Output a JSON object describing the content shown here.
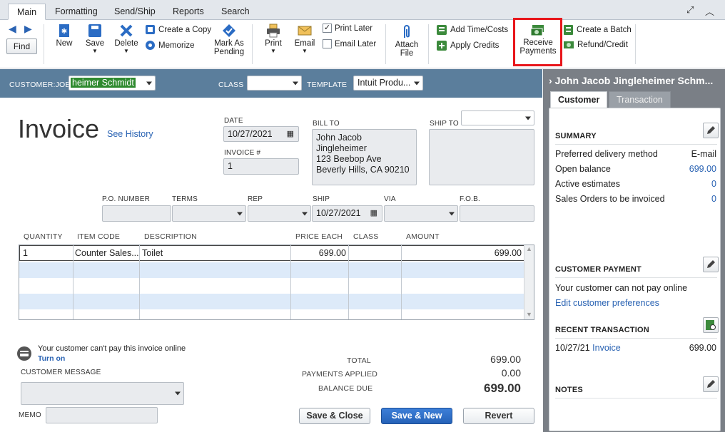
{
  "tabs": [
    "Main",
    "Formatting",
    "Send/Ship",
    "Reports",
    "Search"
  ],
  "toolbar": {
    "find": "Find",
    "new": "New",
    "save": "Save",
    "delete": "Delete",
    "create_copy": "Create a Copy",
    "memorize": "Memorize",
    "mark_as_pending_1": "Mark As",
    "mark_as_pending_2": "Pending",
    "print": "Print",
    "email": "Email",
    "print_later": "Print Later",
    "email_later": "Email Later",
    "attach_file_1": "Attach",
    "attach_file_2": "File",
    "add_time_costs": "Add Time/Costs",
    "apply_credits": "Apply Credits",
    "receive_payments_1": "Receive",
    "receive_payments_2": "Payments",
    "create_batch": "Create a Batch",
    "refund_credit": "Refund/Credit"
  },
  "header": {
    "customer_job_label": "CUSTOMER:JOB",
    "customer_job_value": "heimer Schmidt",
    "class_label": "CLASS",
    "template_label": "TEMPLATE",
    "template_value": "Intuit Produ..."
  },
  "form": {
    "title": "Invoice",
    "see_history": "See History",
    "date_label": "DATE",
    "date_value": "10/27/2021",
    "invoice_no_label": "INVOICE #",
    "invoice_no_value": "1",
    "bill_to_label": "BILL TO",
    "bill_to_lines": [
      "John Jacob Jingleheimer",
      "123 Beebop Ave",
      "Beverly Hills, CA 90210"
    ],
    "ship_to_label": "SHIP TO",
    "po_label": "P.O. NUMBER",
    "terms_label": "TERMS",
    "rep_label": "REP",
    "ship_label": "SHIP",
    "ship_value": "10/27/2021",
    "via_label": "VIA",
    "fob_label": "F.O.B."
  },
  "grid": {
    "columns": [
      "QUANTITY",
      "ITEM CODE",
      "DESCRIPTION",
      "PRICE EACH",
      "CLASS",
      "AMOUNT"
    ],
    "rows": [
      {
        "quantity": "1",
        "item_code": "Counter Sales...",
        "description": "Toilet",
        "price_each": "699.00",
        "class": "",
        "amount": "699.00"
      }
    ]
  },
  "footer": {
    "online_msg": "Your customer can't pay this invoice online",
    "turn_on": "Turn on",
    "customer_message_label": "CUSTOMER MESSAGE",
    "memo_label": "MEMO",
    "total_label": "TOTAL",
    "total_value": "699.00",
    "payments_label": "PAYMENTS APPLIED",
    "payments_value": "0.00",
    "balance_label": "BALANCE DUE",
    "balance_value": "699.00",
    "save_close": "Save & Close",
    "save_new": "Save & New",
    "revert": "Revert"
  },
  "panel": {
    "customer_name": "John Jacob Jingleheimer Schm...",
    "tab_customer": "Customer",
    "tab_transaction": "Transaction",
    "summary_title": "SUMMARY",
    "summary": [
      {
        "label": "Preferred delivery method",
        "value": "E-mail"
      },
      {
        "label": "Open balance",
        "value": "699.00"
      },
      {
        "label": "Active estimates",
        "value": "0"
      },
      {
        "label": "Sales Orders to be invoiced",
        "value": "0"
      }
    ],
    "payment_title": "CUSTOMER PAYMENT",
    "payment_msg": "Your customer can not pay online",
    "edit_prefs": "Edit customer preferences",
    "recent_title": "RECENT TRANSACTION",
    "recent_date": "10/27/21",
    "recent_type": "Invoice",
    "recent_amount": "699.00",
    "notes_title": "NOTES"
  },
  "colors": {
    "accent_blue": "#2a63b3",
    "header_bar": "#5b7e9c",
    "highlight_red": "#e8161b",
    "customer_field_green": "#2f8a2f"
  }
}
